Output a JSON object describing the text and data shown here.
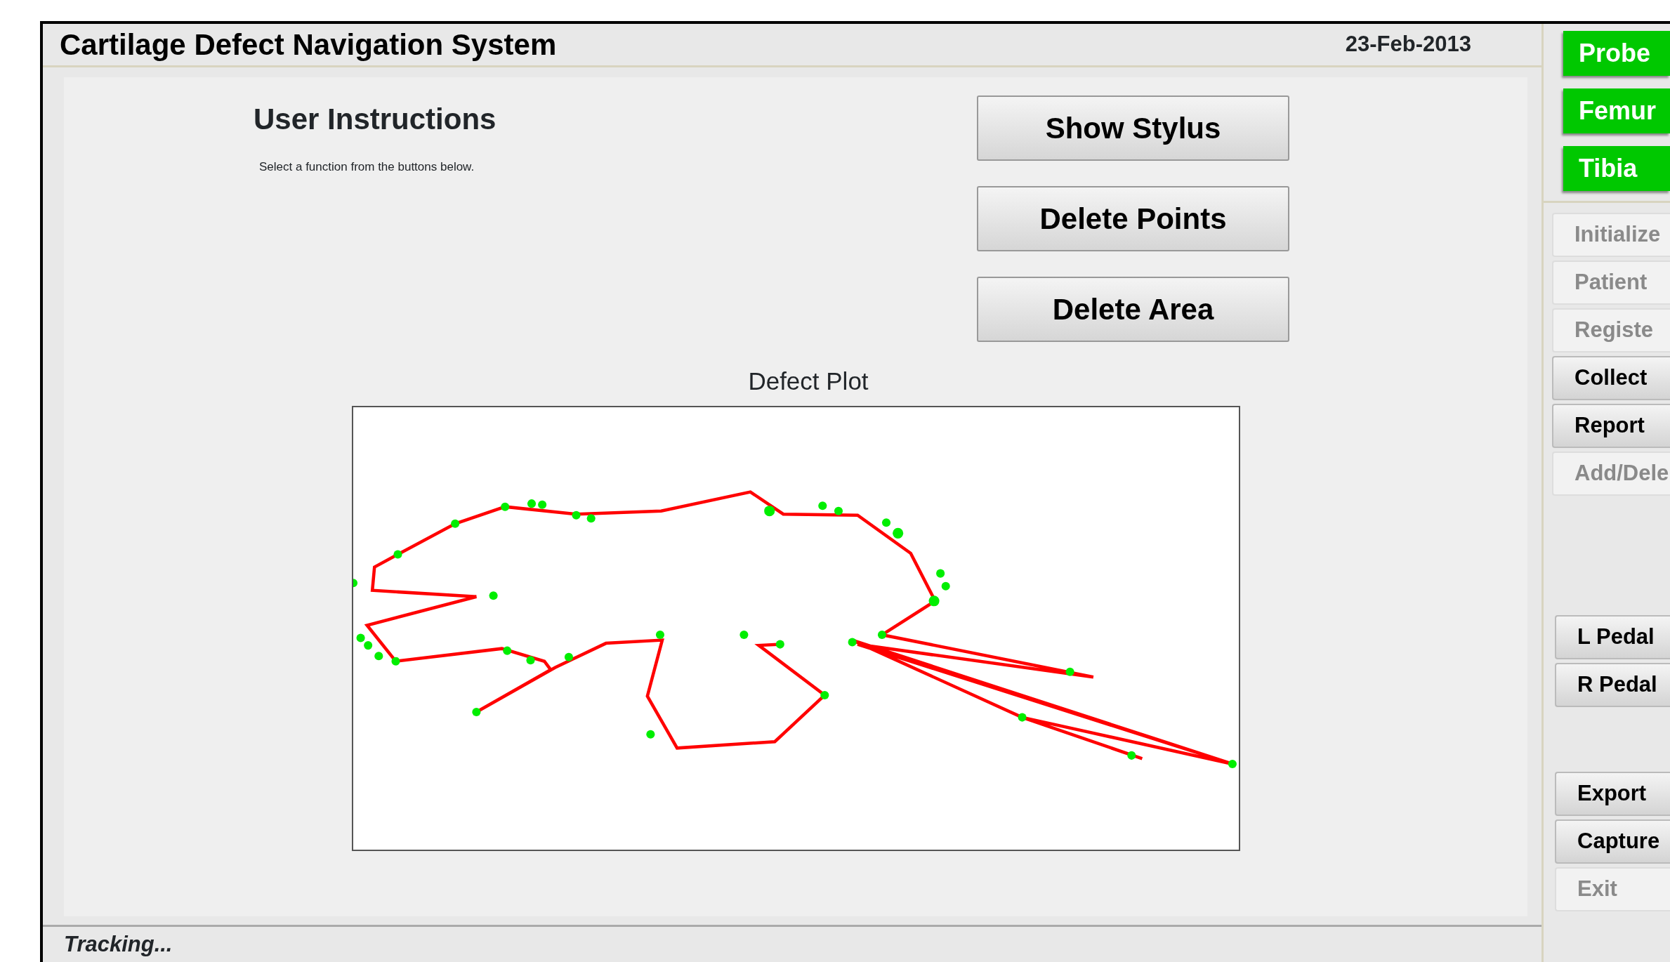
{
  "window": {
    "title": "Cartilage Defect Navigation System",
    "date": "23-Feb-2013"
  },
  "instructions": {
    "heading": "User Instructions",
    "text": "Select a function from the buttons below."
  },
  "actions": [
    {
      "label": "Show Stylus"
    },
    {
      "label": "Delete Points"
    },
    {
      "label": "Delete Area"
    }
  ],
  "plot": {
    "title": "Defect Plot"
  },
  "tools": [
    {
      "label": "Probe",
      "tracked": true
    },
    {
      "label": "Femur",
      "tracked": true
    },
    {
      "label": "Tibia",
      "tracked": true
    }
  ],
  "steps": [
    {
      "label": "Initialize",
      "disabled": true
    },
    {
      "label": "Patient",
      "disabled": true
    },
    {
      "label": "Registe",
      "disabled": true
    },
    {
      "label": "Collect",
      "disabled": false
    },
    {
      "label": "Report",
      "disabled": false
    },
    {
      "label": "Add/Dele",
      "disabled": true
    }
  ],
  "pedals": [
    {
      "label": "L Pedal",
      "disabled": false
    },
    {
      "label": "R Pedal",
      "disabled": false
    }
  ],
  "output": [
    {
      "label": "Export",
      "disabled": false
    },
    {
      "label": "Capture",
      "disabled": false
    },
    {
      "label": "Exit",
      "disabled": true
    }
  ],
  "status_bar": "Tracking..."
}
